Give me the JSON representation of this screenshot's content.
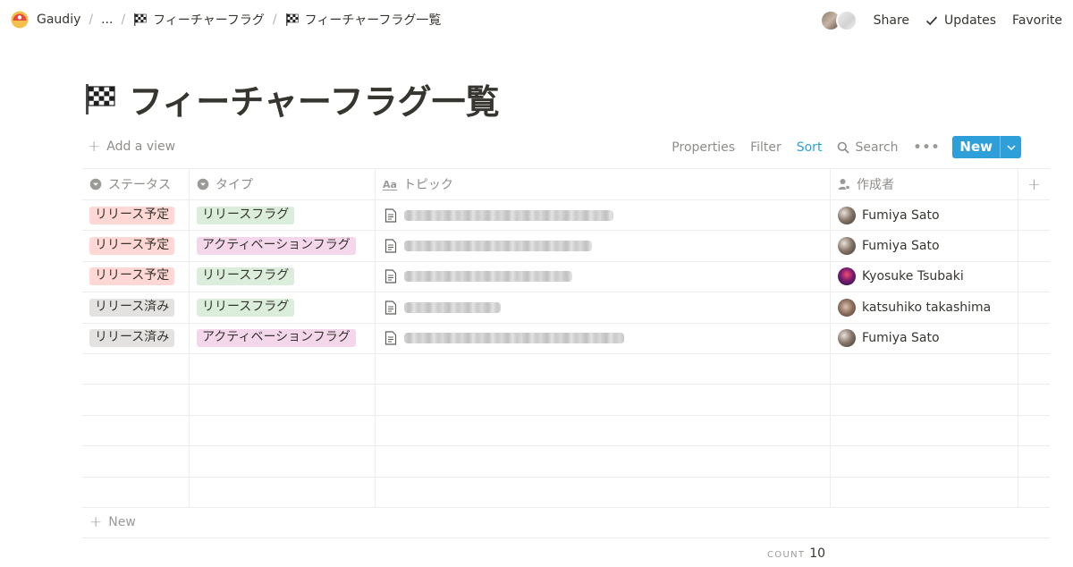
{
  "breadcrumb": {
    "workspace": "Gaudiy",
    "ellipsis": "...",
    "parent": "フィーチャーフラグ",
    "current": "フィーチャーフラグ一覧"
  },
  "topbar": {
    "share": "Share",
    "updates": "Updates",
    "favorite": "Favorite"
  },
  "page": {
    "title": "フィーチャーフラグ一覧",
    "icon": "checkered-flag-icon"
  },
  "toolbar": {
    "add_view": "Add a view",
    "properties": "Properties",
    "filter": "Filter",
    "sort": "Sort",
    "search": "Search",
    "more": "•••",
    "new": "New"
  },
  "columns": [
    {
      "label": "ステータス",
      "icon": "select-icon"
    },
    {
      "label": "タイプ",
      "icon": "select-icon"
    },
    {
      "label": "トピック",
      "icon": "text-aa-icon"
    },
    {
      "label": "作成者",
      "icon": "person-icon"
    }
  ],
  "rows": [
    {
      "status": "リリース予定",
      "status_color": "red",
      "type": "リリースフラグ",
      "type_color": "green",
      "author": "Fumiya Sato",
      "avatar": "fumiya"
    },
    {
      "status": "リリース予定",
      "status_color": "red",
      "type": "アクティベーションフラグ",
      "type_color": "pink",
      "author": "Fumiya Sato",
      "avatar": "fumiya"
    },
    {
      "status": "リリース予定",
      "status_color": "red",
      "type": "リリースフラグ",
      "type_color": "green",
      "author": "Kyosuke Tsubaki",
      "avatar": "kyosuke"
    },
    {
      "status": "リリース済み",
      "status_color": "gray",
      "type": "リリースフラグ",
      "type_color": "green",
      "author": "katsuhiko takashima",
      "avatar": "katsuhiko"
    },
    {
      "status": "リリース済み",
      "status_color": "gray",
      "type": "アクティベーションフラグ",
      "type_color": "pink",
      "author": "Fumiya Sato",
      "avatar": "fumiya"
    }
  ],
  "new_row": "New",
  "footer": {
    "count_label": "COUNT",
    "count_value": "10"
  },
  "colors": {
    "accent": "#2e9fd8",
    "text": "#37352f",
    "muted": "#8f8d89",
    "tag_red": "#ffd7d4",
    "tag_gray": "#e3e2e0",
    "tag_green": "#dbeddb",
    "tag_pink": "#f5d7ec"
  }
}
